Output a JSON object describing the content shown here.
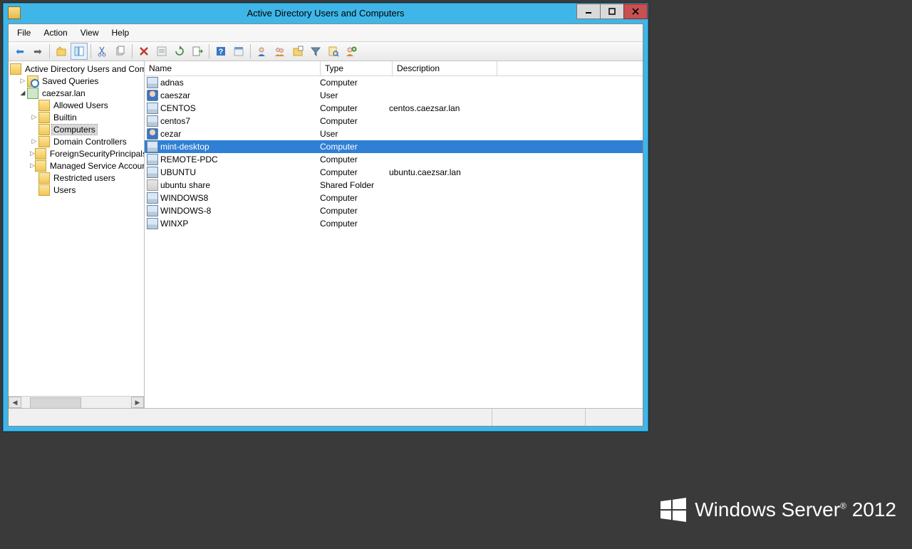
{
  "window": {
    "title": "Active Directory Users and Computers"
  },
  "menu": [
    "File",
    "Action",
    "View",
    "Help"
  ],
  "tree": {
    "root": "Active Directory Users and Computers",
    "saved_queries": "Saved Queries",
    "domain": "caezsar.lan",
    "nodes": [
      {
        "label": "Allowed Users",
        "expander": ""
      },
      {
        "label": "Builtin",
        "expander": "▷"
      },
      {
        "label": "Computers",
        "expander": "",
        "selected": true
      },
      {
        "label": "Domain Controllers",
        "expander": "▷"
      },
      {
        "label": "ForeignSecurityPrincipals",
        "expander": "▷"
      },
      {
        "label": "Managed Service Accounts",
        "expander": "▷"
      },
      {
        "label": "Restricted users",
        "expander": ""
      },
      {
        "label": "Users",
        "expander": ""
      }
    ]
  },
  "columns": {
    "name": "Name",
    "type": "Type",
    "desc": "Description"
  },
  "col_widths": {
    "name": 240,
    "type": 94,
    "desc": 140
  },
  "rows": [
    {
      "name": "adnas",
      "type": "Computer",
      "desc": "",
      "icon": "computer"
    },
    {
      "name": "caeszar",
      "type": "User",
      "desc": "",
      "icon": "user"
    },
    {
      "name": "CENTOS",
      "type": "Computer",
      "desc": "centos.caezsar.lan",
      "icon": "computer"
    },
    {
      "name": "centos7",
      "type": "Computer",
      "desc": "",
      "icon": "computer"
    },
    {
      "name": "cezar",
      "type": "User",
      "desc": "",
      "icon": "user"
    },
    {
      "name": "mint-desktop",
      "type": "Computer",
      "desc": "",
      "icon": "computer",
      "selected": true
    },
    {
      "name": "REMOTE-PDC",
      "type": "Computer",
      "desc": "",
      "icon": "computer"
    },
    {
      "name": "UBUNTU",
      "type": "Computer",
      "desc": "ubuntu.caezsar.lan",
      "icon": "computer"
    },
    {
      "name": "ubuntu share",
      "type": "Shared Folder",
      "desc": "",
      "icon": "share"
    },
    {
      "name": "WINDOWS8",
      "type": "Computer",
      "desc": "",
      "icon": "computer"
    },
    {
      "name": "WINDOWS-8",
      "type": "Computer",
      "desc": "",
      "icon": "computer"
    },
    {
      "name": "WINXP",
      "type": "Computer",
      "desc": "",
      "icon": "computer"
    }
  ],
  "watermark": {
    "brand": "Windows Server",
    "year": "2012"
  }
}
